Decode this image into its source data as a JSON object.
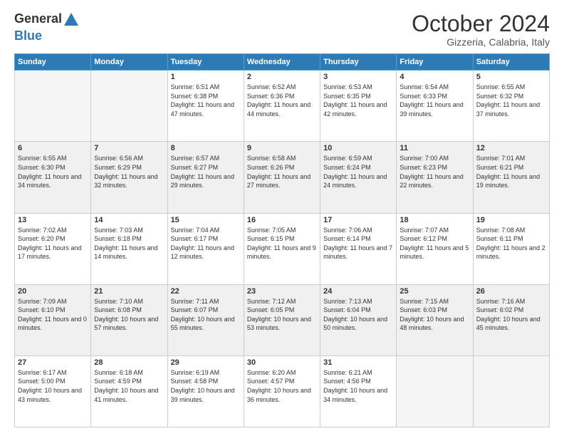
{
  "logo": {
    "general": "General",
    "blue": "Blue"
  },
  "header": {
    "month": "October 2024",
    "location": "Gizzeria, Calabria, Italy"
  },
  "weekdays": [
    "Sunday",
    "Monday",
    "Tuesday",
    "Wednesday",
    "Thursday",
    "Friday",
    "Saturday"
  ],
  "weeks": [
    [
      {
        "day": "",
        "info": ""
      },
      {
        "day": "",
        "info": ""
      },
      {
        "day": "1",
        "info": "Sunrise: 6:51 AM\nSunset: 6:38 PM\nDaylight: 11 hours and 47 minutes."
      },
      {
        "day": "2",
        "info": "Sunrise: 6:52 AM\nSunset: 6:36 PM\nDaylight: 11 hours and 44 minutes."
      },
      {
        "day": "3",
        "info": "Sunrise: 6:53 AM\nSunset: 6:35 PM\nDaylight: 11 hours and 42 minutes."
      },
      {
        "day": "4",
        "info": "Sunrise: 6:54 AM\nSunset: 6:33 PM\nDaylight: 11 hours and 39 minutes."
      },
      {
        "day": "5",
        "info": "Sunrise: 6:55 AM\nSunset: 6:32 PM\nDaylight: 11 hours and 37 minutes."
      }
    ],
    [
      {
        "day": "6",
        "info": "Sunrise: 6:55 AM\nSunset: 6:30 PM\nDaylight: 11 hours and 34 minutes."
      },
      {
        "day": "7",
        "info": "Sunrise: 6:56 AM\nSunset: 6:29 PM\nDaylight: 11 hours and 32 minutes."
      },
      {
        "day": "8",
        "info": "Sunrise: 6:57 AM\nSunset: 6:27 PM\nDaylight: 11 hours and 29 minutes."
      },
      {
        "day": "9",
        "info": "Sunrise: 6:58 AM\nSunset: 6:26 PM\nDaylight: 11 hours and 27 minutes."
      },
      {
        "day": "10",
        "info": "Sunrise: 6:59 AM\nSunset: 6:24 PM\nDaylight: 11 hours and 24 minutes."
      },
      {
        "day": "11",
        "info": "Sunrise: 7:00 AM\nSunset: 6:23 PM\nDaylight: 11 hours and 22 minutes."
      },
      {
        "day": "12",
        "info": "Sunrise: 7:01 AM\nSunset: 6:21 PM\nDaylight: 11 hours and 19 minutes."
      }
    ],
    [
      {
        "day": "13",
        "info": "Sunrise: 7:02 AM\nSunset: 6:20 PM\nDaylight: 11 hours and 17 minutes."
      },
      {
        "day": "14",
        "info": "Sunrise: 7:03 AM\nSunset: 6:18 PM\nDaylight: 11 hours and 14 minutes."
      },
      {
        "day": "15",
        "info": "Sunrise: 7:04 AM\nSunset: 6:17 PM\nDaylight: 11 hours and 12 minutes."
      },
      {
        "day": "16",
        "info": "Sunrise: 7:05 AM\nSunset: 6:15 PM\nDaylight: 11 hours and 9 minutes."
      },
      {
        "day": "17",
        "info": "Sunrise: 7:06 AM\nSunset: 6:14 PM\nDaylight: 11 hours and 7 minutes."
      },
      {
        "day": "18",
        "info": "Sunrise: 7:07 AM\nSunset: 6:12 PM\nDaylight: 11 hours and 5 minutes."
      },
      {
        "day": "19",
        "info": "Sunrise: 7:08 AM\nSunset: 6:11 PM\nDaylight: 11 hours and 2 minutes."
      }
    ],
    [
      {
        "day": "20",
        "info": "Sunrise: 7:09 AM\nSunset: 6:10 PM\nDaylight: 11 hours and 0 minutes."
      },
      {
        "day": "21",
        "info": "Sunrise: 7:10 AM\nSunset: 6:08 PM\nDaylight: 10 hours and 57 minutes."
      },
      {
        "day": "22",
        "info": "Sunrise: 7:11 AM\nSunset: 6:07 PM\nDaylight: 10 hours and 55 minutes."
      },
      {
        "day": "23",
        "info": "Sunrise: 7:12 AM\nSunset: 6:05 PM\nDaylight: 10 hours and 53 minutes."
      },
      {
        "day": "24",
        "info": "Sunrise: 7:13 AM\nSunset: 6:04 PM\nDaylight: 10 hours and 50 minutes."
      },
      {
        "day": "25",
        "info": "Sunrise: 7:15 AM\nSunset: 6:03 PM\nDaylight: 10 hours and 48 minutes."
      },
      {
        "day": "26",
        "info": "Sunrise: 7:16 AM\nSunset: 6:02 PM\nDaylight: 10 hours and 45 minutes."
      }
    ],
    [
      {
        "day": "27",
        "info": "Sunrise: 6:17 AM\nSunset: 5:00 PM\nDaylight: 10 hours and 43 minutes."
      },
      {
        "day": "28",
        "info": "Sunrise: 6:18 AM\nSunset: 4:59 PM\nDaylight: 10 hours and 41 minutes."
      },
      {
        "day": "29",
        "info": "Sunrise: 6:19 AM\nSunset: 4:58 PM\nDaylight: 10 hours and 39 minutes."
      },
      {
        "day": "30",
        "info": "Sunrise: 6:20 AM\nSunset: 4:57 PM\nDaylight: 10 hours and 36 minutes."
      },
      {
        "day": "31",
        "info": "Sunrise: 6:21 AM\nSunset: 4:56 PM\nDaylight: 10 hours and 34 minutes."
      },
      {
        "day": "",
        "info": ""
      },
      {
        "day": "",
        "info": ""
      }
    ]
  ]
}
